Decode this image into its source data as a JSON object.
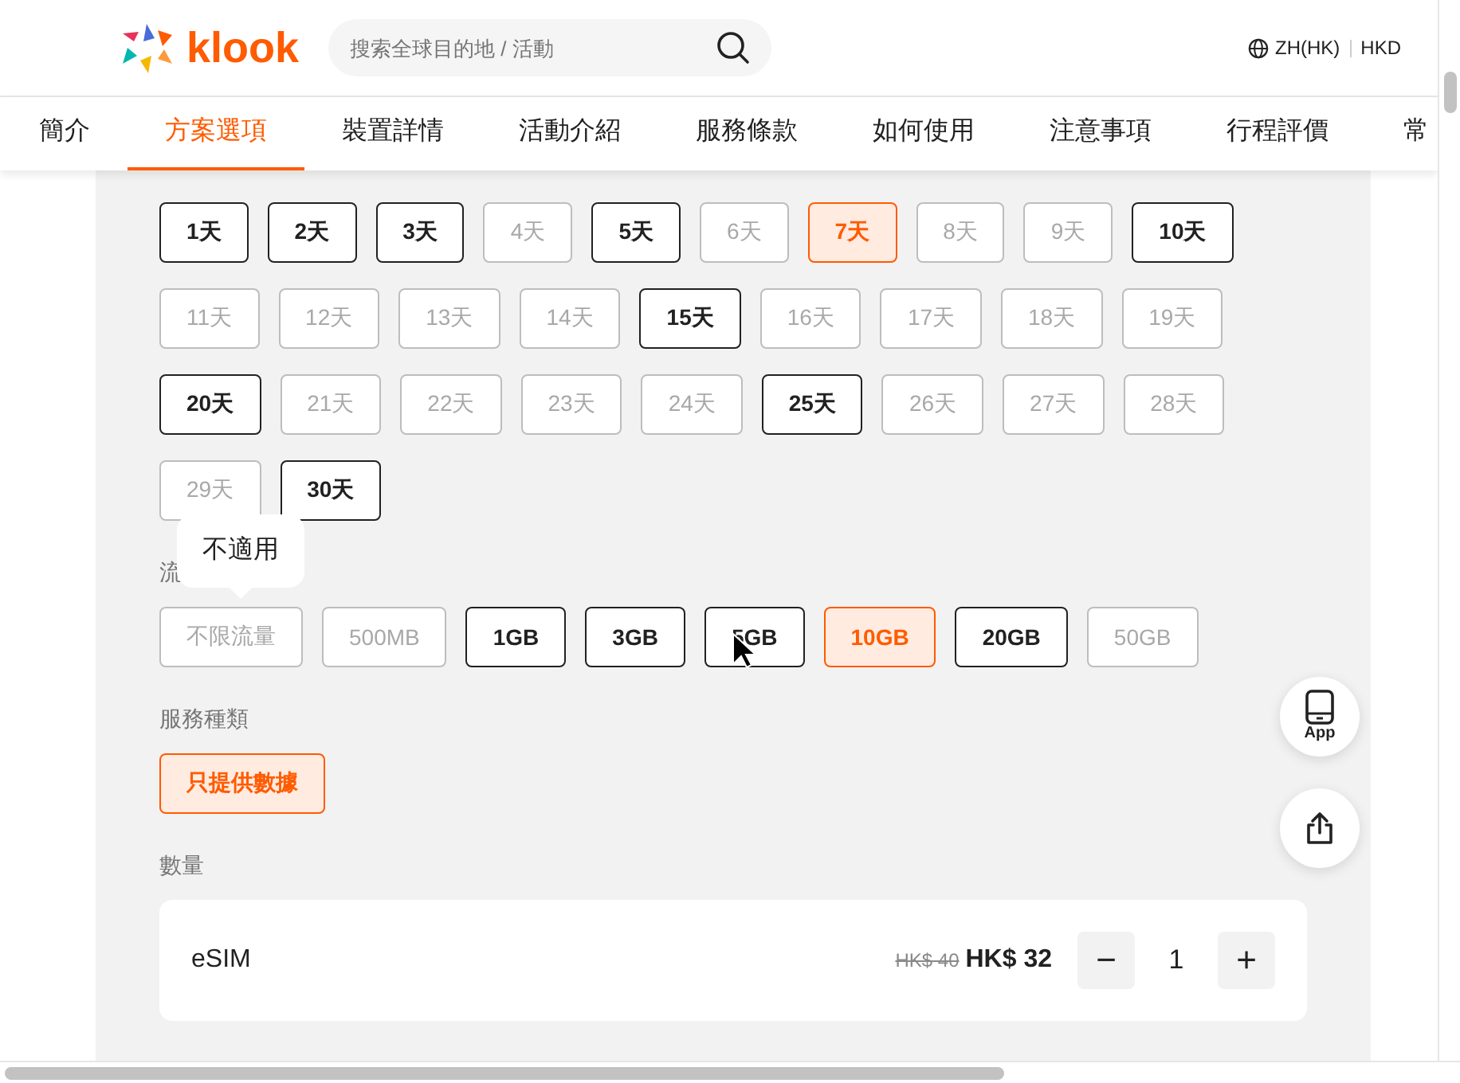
{
  "header": {
    "logo": "klook",
    "search": {
      "placeholder": "搜索全球目的地 / 活動"
    },
    "language": "ZH(HK)",
    "currency": "HKD"
  },
  "tabs": [
    {
      "label": "簡介",
      "selected": false
    },
    {
      "label": "方案選項",
      "selected": true
    },
    {
      "label": "裝置詳情",
      "selected": false
    },
    {
      "label": "活動介紹",
      "selected": false
    },
    {
      "label": "服務條款",
      "selected": false
    },
    {
      "label": "如何使用",
      "selected": false
    },
    {
      "label": "注意事項",
      "selected": false
    },
    {
      "label": "行程評價",
      "selected": false
    },
    {
      "label": "常",
      "selected": false
    }
  ],
  "day_options": [
    {
      "label": "1天",
      "selected": false,
      "disabled": false
    },
    {
      "label": "2天",
      "selected": false,
      "disabled": false
    },
    {
      "label": "3天",
      "selected": false,
      "disabled": false
    },
    {
      "label": "4天",
      "selected": false,
      "disabled": true
    },
    {
      "label": "5天",
      "selected": false,
      "disabled": false
    },
    {
      "label": "6天",
      "selected": false,
      "disabled": true
    },
    {
      "label": "7天",
      "selected": true,
      "disabled": false
    },
    {
      "label": "8天",
      "selected": false,
      "disabled": true
    },
    {
      "label": "9天",
      "selected": false,
      "disabled": true
    },
    {
      "label": "10天",
      "selected": false,
      "disabled": false
    },
    {
      "label": "11天",
      "selected": false,
      "disabled": true
    },
    {
      "label": "12天",
      "selected": false,
      "disabled": true
    },
    {
      "label": "13天",
      "selected": false,
      "disabled": true
    },
    {
      "label": "14天",
      "selected": false,
      "disabled": true
    },
    {
      "label": "15天",
      "selected": false,
      "disabled": false
    },
    {
      "label": "16天",
      "selected": false,
      "disabled": true
    },
    {
      "label": "17天",
      "selected": false,
      "disabled": true
    },
    {
      "label": "18天",
      "selected": false,
      "disabled": true
    },
    {
      "label": "19天",
      "selected": false,
      "disabled": true
    },
    {
      "label": "20天",
      "selected": false,
      "disabled": false
    },
    {
      "label": "21天",
      "selected": false,
      "disabled": true
    },
    {
      "label": "22天",
      "selected": false,
      "disabled": true
    },
    {
      "label": "23天",
      "selected": false,
      "disabled": true
    },
    {
      "label": "24天",
      "selected": false,
      "disabled": true
    },
    {
      "label": "25天",
      "selected": false,
      "disabled": false
    },
    {
      "label": "26天",
      "selected": false,
      "disabled": true
    },
    {
      "label": "27天",
      "selected": false,
      "disabled": true
    },
    {
      "label": "28天",
      "selected": false,
      "disabled": true
    },
    {
      "label": "29天",
      "selected": false,
      "disabled": true
    },
    {
      "label": "30天",
      "selected": false,
      "disabled": false
    }
  ],
  "data_section": {
    "label": "流",
    "tooltip": "不適用",
    "options": [
      {
        "label": "不限流量",
        "selected": false,
        "disabled": true
      },
      {
        "label": "500MB",
        "selected": false,
        "disabled": true
      },
      {
        "label": "1GB",
        "selected": false,
        "disabled": false
      },
      {
        "label": "3GB",
        "selected": false,
        "disabled": false
      },
      {
        "label": "5GB",
        "selected": false,
        "disabled": false
      },
      {
        "label": "10GB",
        "selected": true,
        "disabled": false
      },
      {
        "label": "20GB",
        "selected": false,
        "disabled": false
      },
      {
        "label": "50GB",
        "selected": false,
        "disabled": true
      }
    ]
  },
  "service_section": {
    "label": "服務種類",
    "options": [
      {
        "label": "只提供數據",
        "selected": true,
        "disabled": false
      }
    ]
  },
  "quantity_section": {
    "label": "數量",
    "item": {
      "name": "eSIM",
      "original_price": "HK$ 40",
      "price": "HK$ 32",
      "quantity": "1",
      "minus": "−",
      "plus": "+"
    }
  },
  "floating": {
    "app_label": "App"
  }
}
